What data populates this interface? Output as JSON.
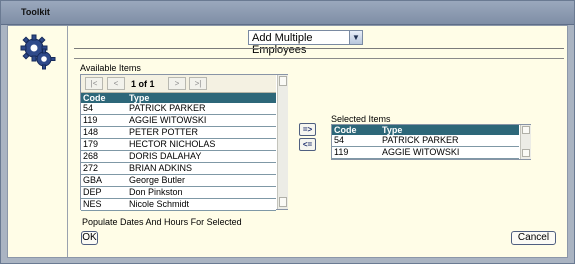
{
  "window": {
    "title": "Toolkit"
  },
  "dropdown": {
    "value": "Add Multiple Employees"
  },
  "available": {
    "label": "Available Items",
    "pager": {
      "first": "|<",
      "prev": "<",
      "page_info": "1 of 1",
      "next": ">",
      "last": ">|"
    },
    "columns": [
      "Code",
      "Type"
    ],
    "rows": [
      {
        "code": "54",
        "type": "PATRICK PARKER"
      },
      {
        "code": "119",
        "type": "AGGIE WITOWSKI"
      },
      {
        "code": "148",
        "type": "PETER POTTER"
      },
      {
        "code": "179",
        "type": "HECTOR NICHOLAS"
      },
      {
        "code": "268",
        "type": "DORIS DALAHAY"
      },
      {
        "code": "272",
        "type": "BRIAN ADKINS"
      },
      {
        "code": "GBA",
        "type": "George Butler"
      },
      {
        "code": "DEP",
        "type": "Don Pinkston"
      },
      {
        "code": "NES",
        "type": "Nicole Schmidt"
      }
    ]
  },
  "move": {
    "add": "=>",
    "remove": "<="
  },
  "selected": {
    "label": "Selected Items",
    "columns": [
      "Code",
      "Type"
    ],
    "rows": [
      {
        "code": "54",
        "type": "PATRICK PARKER"
      },
      {
        "code": "119",
        "type": "AGGIE WITOWSKI"
      }
    ]
  },
  "populate_label": "Populate Dates And Hours For Selected",
  "ok_label": "OK",
  "cancel_label": "Cancel",
  "icons": {
    "app": "gears-icon",
    "dropdown": "chevron-down-icon"
  }
}
